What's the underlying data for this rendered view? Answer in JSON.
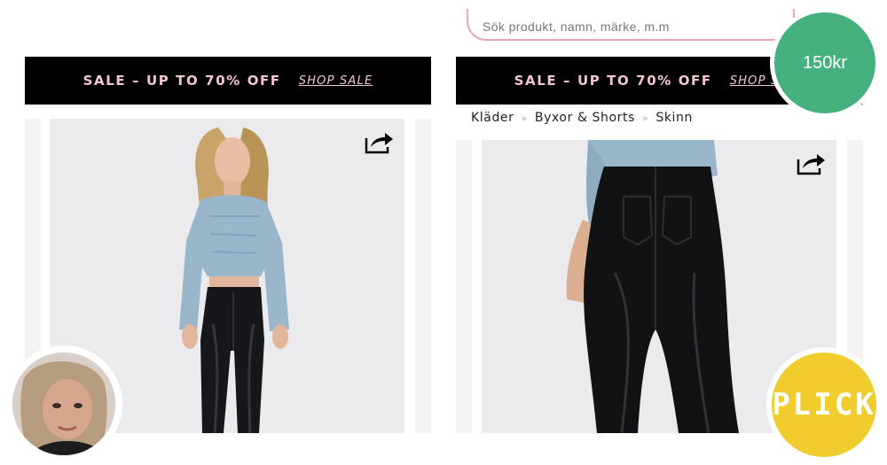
{
  "search": {
    "placeholder": "Sök produkt, namn, märke, m.m"
  },
  "banner": {
    "sale_text": "SALE – UP TO 70% OFF",
    "shop_link": "SHOP SALE"
  },
  "breadcrumb": {
    "items": [
      "Kläder",
      "Byxor & Shorts",
      "Skinn"
    ],
    "separator": "»"
  },
  "price": {
    "label": "150kr"
  },
  "plick": {
    "label": "PLICK"
  },
  "colors": {
    "price_bubble": "#45b17e",
    "plick_bubble": "#f0cd2c",
    "banner_text": "#f3c6cf",
    "search_border": "#e9a6b6"
  },
  "icons": [
    "share-icon",
    "avatar"
  ]
}
